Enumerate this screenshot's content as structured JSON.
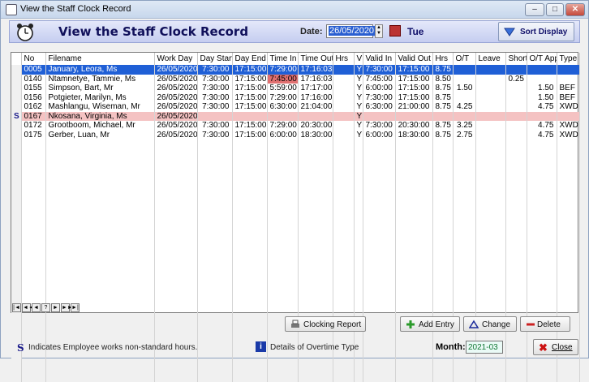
{
  "window": {
    "title": "View the Staff Clock Record",
    "min": "–",
    "max": "□",
    "close": "✕"
  },
  "header": {
    "title": "View the Staff Clock Record",
    "date_label": "Date:",
    "date_value": "26/05/2020",
    "day": "Tue",
    "sort_label": "Sort Display"
  },
  "columns": [
    "No",
    "Filename",
    "Work Day",
    "Day Start",
    "Day End",
    "Time In",
    "Time Out",
    "Hrs",
    "V",
    "Valid In",
    "Valid Out",
    "Hrs",
    "O/T",
    "Leave",
    "Short",
    "O/T App",
    "Type"
  ],
  "rows": [
    [
      "0005",
      "January, Leora, Ms",
      "26/05/2020",
      "7:30:00",
      "17:15:00",
      "7:29:00",
      "17:16:03",
      "",
      "Y",
      "7:30:00",
      "17:15:00",
      "8.75",
      "",
      "",
      "",
      "",
      ""
    ],
    [
      "0140",
      "Ntamnetye, Tammie, Ms",
      "26/05/2020",
      "7:30:00",
      "17:15:00",
      "7:45:00",
      "17:16:03",
      "",
      "Y",
      "7:45:00",
      "17:15:00",
      "8.50",
      "",
      "",
      "0.25",
      "",
      ""
    ],
    [
      "0155",
      "Simpson, Bart, Mr",
      "26/05/2020",
      "7:30:00",
      "17:15:00",
      "5:59:00",
      "17:17:00",
      "",
      "Y",
      "6:00:00",
      "17:15:00",
      "8.75",
      "1.50",
      "",
      "",
      "1.50",
      "BEF"
    ],
    [
      "0156",
      "Potgieter, Marilyn, Ms",
      "26/05/2020",
      "7:30:00",
      "17:15:00",
      "7:29:00",
      "17:16:00",
      "",
      "Y",
      "7:30:00",
      "17:15:00",
      "8.75",
      "",
      "",
      "",
      "1.50",
      "BEF"
    ],
    [
      "0162",
      "Mashlangu, Wiseman, Mr",
      "26/05/2020",
      "7:30:00",
      "17:15:00",
      "6:30:00",
      "21:04:00",
      "",
      "Y",
      "6:30:00",
      "21:00:00",
      "8.75",
      "4.25",
      "",
      "",
      "4.75",
      "XWD"
    ],
    [
      "0167",
      "Nkosana, Virginia, Ms",
      "26/05/2020",
      "",
      "",
      "",
      "",
      "",
      "Y",
      "",
      "",
      "",
      "",
      "",
      "",
      "",
      ""
    ],
    [
      "0172",
      "Grootboom, Michael, Mr",
      "26/05/2020",
      "7:30:00",
      "17:15:00",
      "7:29:00",
      "20:30:00",
      "",
      "Y",
      "7:30:00",
      "20:30:00",
      "8.75",
      "3.25",
      "",
      "",
      "4.75",
      "XWD"
    ],
    [
      "0175",
      "Gerber, Luan, Mr",
      "26/05/2020",
      "7:30:00",
      "17:15:00",
      "6:00:00",
      "18:30:00",
      "",
      "Y",
      "6:00:00",
      "18:30:00",
      "8.75",
      "2.75",
      "",
      "",
      "4.75",
      "XWD"
    ]
  ],
  "row_marker": "S",
  "nav": [
    "|◄",
    "◄◄",
    "◄",
    "?",
    "►",
    "►►",
    "►|"
  ],
  "buttons": {
    "clocking_report": "Clocking Report",
    "add_entry": "Add Entry",
    "change": "Change",
    "delete": "Delete",
    "close": "Close"
  },
  "footer": {
    "legend_symbol": "S",
    "legend_text": "Indicates Employee works non-standard hours.",
    "info_symbol": "i",
    "info_text": "Details of Overtime Type",
    "month_label": "Month:",
    "month_value": "2021-03"
  },
  "colors": {
    "selected": "#1f5fd6",
    "highlight": "#f4c2c2",
    "late": "#e07070"
  }
}
